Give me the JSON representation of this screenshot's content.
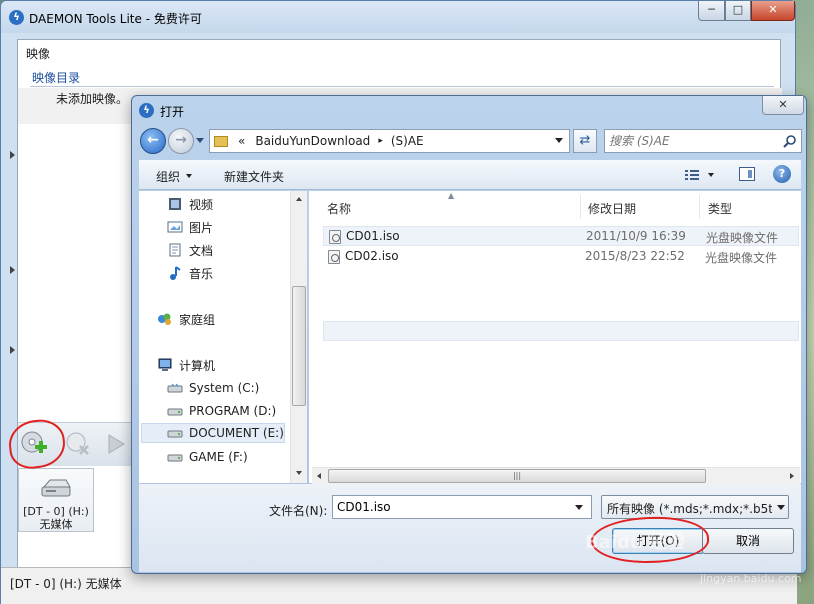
{
  "main_window": {
    "title": "DAEMON Tools Lite - 免费许可",
    "menu_image": "映像",
    "catalog_header": "映像目录",
    "no_images_text": "未添加映像。",
    "drive_tile_label_line1": "[DT - 0] (H:)",
    "drive_tile_label_line2": "无媒体",
    "status_text": "[DT - 0] (H:) 无媒体",
    "icons": [
      "app-logo-icon",
      "add-image-icon",
      "remove-image-icon",
      "play-icon",
      "virtual-drive-icon"
    ]
  },
  "dialog": {
    "title": "打开",
    "close_glyph": "✕",
    "breadcrumb_prefix": "«",
    "breadcrumb": [
      "BaiduYunDownload",
      "(S)AE"
    ],
    "breadcrumb_separator": "▸",
    "search_placeholder": "搜索 (S)AE",
    "organize_label": "组织",
    "new_folder_label": "新建文件夹",
    "help_glyph": "?",
    "nav_items": [
      {
        "label": "视频",
        "icon": "video-library-icon"
      },
      {
        "label": "图片",
        "icon": "pictures-library-icon"
      },
      {
        "label": "文档",
        "icon": "documents-library-icon"
      },
      {
        "label": "音乐",
        "icon": "music-library-icon"
      },
      {
        "label": "家庭组",
        "icon": "homegroup-icon"
      },
      {
        "label": "计算机",
        "icon": "computer-icon"
      },
      {
        "label": "System (C:)",
        "icon": "drive-icon"
      },
      {
        "label": "PROGRAM (D:)",
        "icon": "drive-icon"
      },
      {
        "label": "DOCUMENT (E:)",
        "icon": "drive-icon",
        "selected": true
      },
      {
        "label": "GAME (F:)",
        "icon": "drive-icon"
      }
    ],
    "columns": {
      "name": "名称",
      "modified": "修改日期",
      "type": "类型"
    },
    "files": [
      {
        "name": "CD01.iso",
        "modified": "2011/10/9 16:39",
        "type": "光盘映像文件",
        "selected": true
      },
      {
        "name": "CD02.iso",
        "modified": "2015/8/23 22:52",
        "type": "光盘映像文件"
      }
    ],
    "hscroll_grip": "|||",
    "filename_label": "文件名(N):",
    "filename_value": "CD01.iso",
    "filter_value": "所有映像 (*.mds;*.mdx;*.b5t;*",
    "open_button": "打开(O)",
    "cancel_button": "取消"
  },
  "watermark": {
    "brand": "Baidu 经验",
    "url": "jingyan.baidu.com"
  },
  "colors": {
    "accent": "#2c6fc2",
    "annotation_red": "#e12020",
    "close_red": "#c7452d"
  }
}
